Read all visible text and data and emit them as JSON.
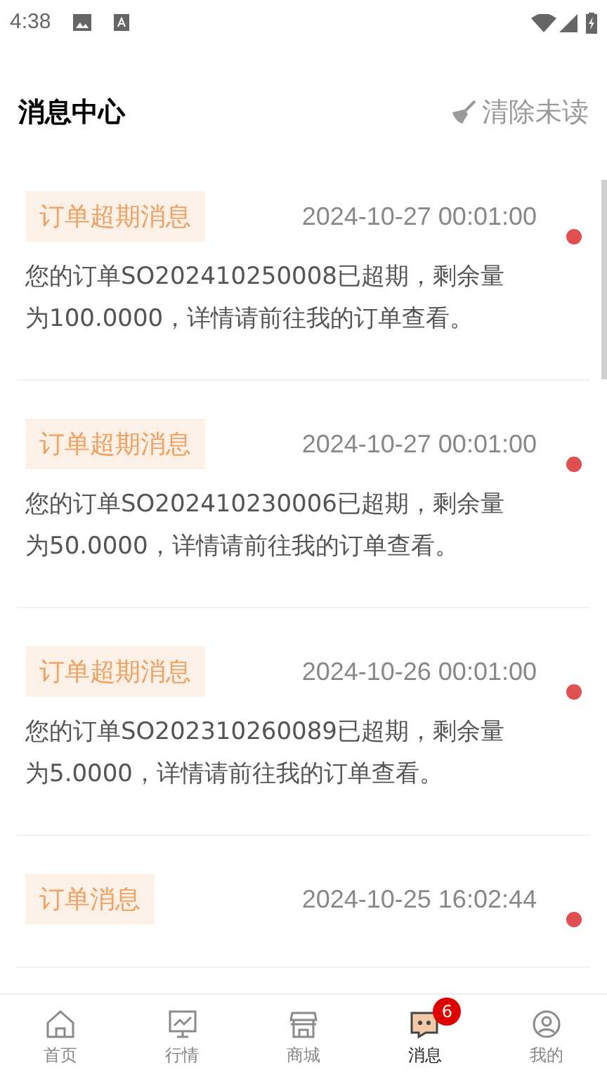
{
  "status_bar": {
    "time": "4:38"
  },
  "header": {
    "title": "消息中心",
    "action": "清除未读"
  },
  "messages": [
    {
      "tag": "订单超期消息",
      "time": "2024-10-27 00:01:00",
      "body": "您的订单SO202410250008已超期，剩余量为100.0000，详情请前往我的订单查看。",
      "unread": true
    },
    {
      "tag": "订单超期消息",
      "time": "2024-10-27 00:01:00",
      "body": "您的订单SO202410230006已超期，剩余量为50.0000，详情请前往我的订单查看。",
      "unread": true
    },
    {
      "tag": "订单超期消息",
      "time": "2024-10-26 00:01:00",
      "body": "您的订单SO202310260089已超期，剩余量为5.0000，详情请前往我的订单查看。",
      "unread": true
    },
    {
      "tag": "订单消息",
      "time": "2024-10-25 16:02:44",
      "unread": true
    }
  ],
  "tab_bar": [
    {
      "kind": "home",
      "label": "首页",
      "selected": false
    },
    {
      "kind": "market",
      "label": "行情",
      "selected": false
    },
    {
      "kind": "shop",
      "label": "商城",
      "selected": false
    },
    {
      "kind": "messages",
      "label": "消息",
      "selected": true,
      "badge": "6"
    },
    {
      "kind": "profile",
      "label": "我的",
      "selected": false
    }
  ]
}
